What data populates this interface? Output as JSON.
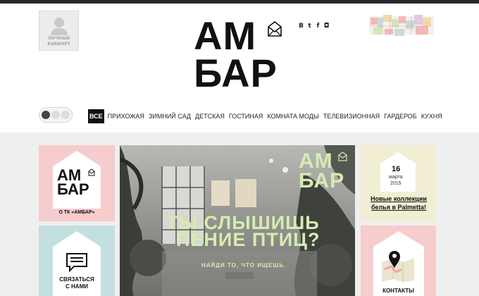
{
  "header": {
    "cabinet_label": "ЛИЧНЫЙ КАБИНЕТ",
    "logo_line1": "АМ",
    "logo_line2": "БАР",
    "social": [
      "В",
      "t",
      "f",
      "◘"
    ]
  },
  "nav": {
    "all_label": "ВСЕ",
    "items": [
      "ПРИХОЖАЯ",
      "ЗИМНИЙ САД",
      "ДЕТСКАЯ",
      "ГОСТИНАЯ",
      "КОМНАТА МОДЫ",
      "ТЕЛЕВИЗИОННАЯ",
      "ГАРДЕРОБ",
      "КУХНЯ"
    ]
  },
  "cards": {
    "about": {
      "logo1": "АМ",
      "logo2": "БАР",
      "label": "О ТК «АМБАР»"
    },
    "contact": {
      "label_line1": "СВЯЗАТЬСЯ",
      "label_line2": "С НАМИ"
    },
    "news": {
      "day": "16",
      "month": "марта",
      "year": "2015",
      "title": "Новые коллекции белья в Palmetta!"
    },
    "contacts": {
      "label": "КОНТАКТЫ"
    }
  },
  "hero": {
    "logo1": "АМ",
    "logo2": "БАР",
    "headline1": "ТЫ СЛЫШИШЬ",
    "headline2": "ПЕНИЕ ПТИЦ?",
    "subtitle": "НАЙДИ ТО, ЧТО ИЩЕШЬ."
  },
  "colors": {
    "pink": "#f6cccd",
    "teal": "#c3dfe0",
    "cream": "#f2eed4",
    "hero_text": "#d6ecb0"
  }
}
